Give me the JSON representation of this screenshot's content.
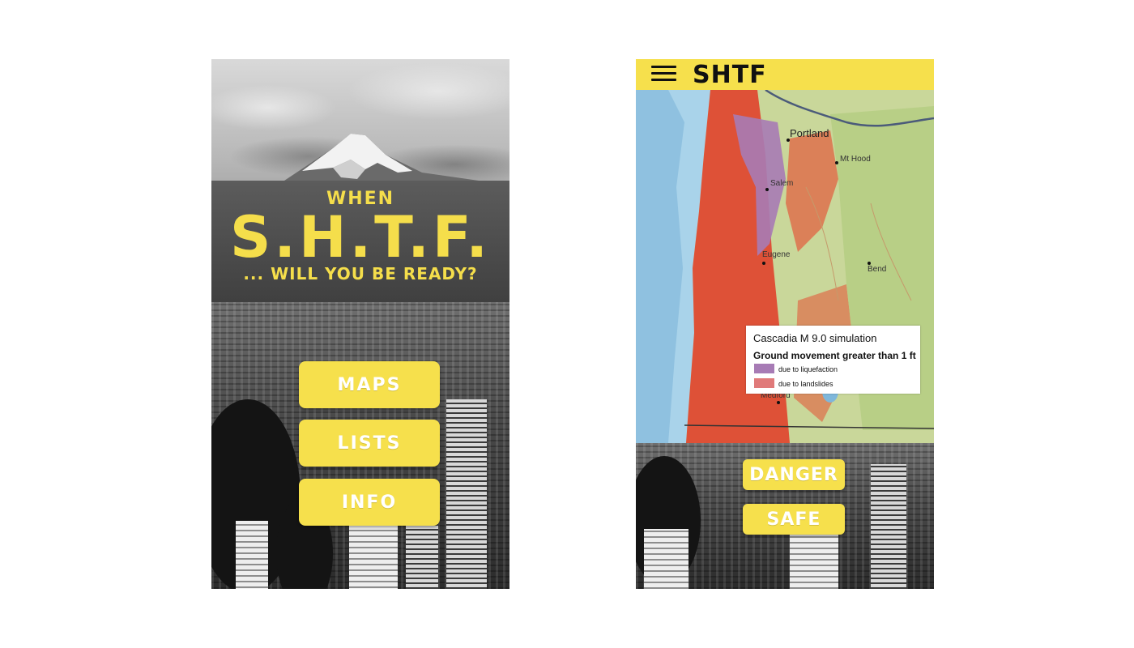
{
  "home": {
    "title_prefix": "WHEN",
    "title_main": "S.H.T.F.",
    "tagline": "... WILL YOU BE READY?",
    "buttons": [
      {
        "label": "MAPS"
      },
      {
        "label": "LISTS"
      },
      {
        "label": "INFO"
      }
    ]
  },
  "map_screen": {
    "brand": "SHTF",
    "map": {
      "cities": [
        {
          "name": "Portland"
        },
        {
          "name": "Mt Hood"
        },
        {
          "name": "Salem"
        },
        {
          "name": "Eugene"
        },
        {
          "name": "Bend"
        },
        {
          "name": "Medford"
        }
      ],
      "legend": {
        "title": "Cascadia M 9.0 simulation",
        "subtitle": "Ground movement greater than 1 ft",
        "items": [
          {
            "label": "due to liquefaction",
            "color": "#a77bb5"
          },
          {
            "label": "due to landslides",
            "color": "#e07a7a"
          }
        ]
      }
    },
    "buttons": [
      {
        "label": "DANGER"
      },
      {
        "label": "SAFE"
      }
    ]
  },
  "colors": {
    "accent_yellow": "#f6e04c",
    "title_yellow": "#f5de4b",
    "landslide_red": "#e0452f",
    "liquefaction_purple": "#a77bb5"
  }
}
